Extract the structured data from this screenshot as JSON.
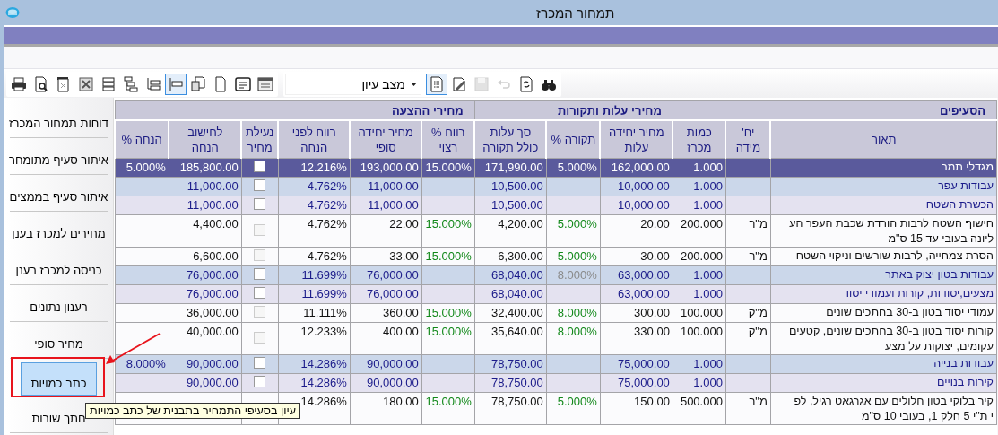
{
  "window": {
    "title": "תמחור המכרז"
  },
  "toolbar": {
    "left_tools": [
      {
        "kind": "print",
        "selected": false,
        "disabled": false
      },
      {
        "kind": "preview",
        "selected": false,
        "disabled": false
      },
      {
        "kind": "pdf",
        "selected": false,
        "disabled": false
      },
      {
        "kind": "excel",
        "selected": false,
        "disabled": false
      },
      {
        "kind": "tree-a",
        "selected": false,
        "disabled": false
      },
      {
        "kind": "tree-b",
        "selected": false,
        "disabled": false
      },
      {
        "kind": "tree-c",
        "selected": false,
        "disabled": false
      },
      {
        "kind": "tree-d",
        "selected": true,
        "disabled": false
      },
      {
        "kind": "copy",
        "selected": false,
        "disabled": false
      },
      {
        "kind": "page",
        "selected": false,
        "disabled": false
      },
      {
        "kind": "frame",
        "selected": false,
        "disabled": false
      },
      {
        "kind": "grid",
        "selected": false,
        "disabled": false
      }
    ],
    "mode_field": {
      "value": "מצב עיון"
    },
    "right_tools": [
      {
        "kind": "doc-list",
        "selected": true,
        "disabled": false
      },
      {
        "kind": "edit",
        "selected": false,
        "disabled": false
      },
      {
        "kind": "save",
        "selected": false,
        "disabled": true
      },
      {
        "kind": "undo",
        "selected": false,
        "disabled": true
      },
      {
        "kind": "refresh",
        "selected": false,
        "disabled": false
      },
      {
        "kind": "find",
        "selected": false,
        "disabled": false
      }
    ]
  },
  "sidebar": {
    "items": [
      {
        "label": "דוחות תמחור המכרז",
        "selected": false
      },
      {
        "label": "איתור סעיף מתומחר",
        "selected": false
      },
      {
        "label": "איתור סעיף בממצים",
        "selected": false
      },
      {
        "label": "מחירים למכרז בענן",
        "selected": false
      },
      {
        "label": "כניסה למכרז בענן",
        "selected": false
      },
      {
        "label": "רענון נתונים",
        "selected": false
      },
      {
        "label": "מחיר סופי",
        "selected": false
      },
      {
        "label": "כתב כמויות",
        "selected": true
      },
      {
        "label": "חתך שורות",
        "selected": false
      }
    ]
  },
  "tooltip": "עיון בסעיפי התמחיר בתבנית של כתב כמויות",
  "table": {
    "groups": [
      {
        "label": "הסעיפים"
      },
      {
        "label": "מחירי עלות ותקורות"
      },
      {
        "label": "מחירי ההצעה"
      }
    ],
    "columns": [
      "תאור",
      "יח'\nמידה",
      "כמות\nמכרז",
      "מחיר יחידה\nעלות",
      "תקורה %",
      "סך עלות\nכולל תקורה",
      "רווח %\nרצוי",
      "מחיר יחידה\nסופי",
      "רווח  לפני\nהנחה",
      "נעילת\nמחיר",
      "לחישוב\nהנחה",
      "הנחה %"
    ],
    "rows": [
      {
        "kind": "chapter",
        "selected": true,
        "overhead_greyed": false,
        "lock": {
          "checked": false,
          "disabled": false
        },
        "cells": [
          "מגדלי תמר",
          null,
          "1.000",
          "162,000.00",
          "5.000%",
          "171,990.00",
          "15.000%",
          "193,000.00",
          "12.216%",
          "",
          "185,800.00",
          "5.000%"
        ]
      },
      {
        "kind": "chapter",
        "selected": false,
        "overhead_greyed": false,
        "lock": {
          "checked": false,
          "disabled": false
        },
        "cells": [
          "עבודות עפר",
          null,
          "1.000",
          "10,000.00",
          null,
          "10,500.00",
          null,
          "11,000.00",
          "4.762%",
          "",
          "11,000.00",
          null
        ]
      },
      {
        "kind": "section",
        "selected": false,
        "overhead_greyed": false,
        "lock": {
          "checked": false,
          "disabled": false
        },
        "cells": [
          "הכשרת השטח",
          null,
          "1.000",
          "10,000.00",
          null,
          "10,500.00",
          null,
          "11,000.00",
          "4.762%",
          "",
          "11,000.00",
          null
        ]
      },
      {
        "kind": "item",
        "selected": false,
        "overhead_greyed": false,
        "lock": {
          "checked": false,
          "disabled": true
        },
        "cells": [
          "חישוף השטח לרבות הורדת שכבת העפר הע\nליונה בעובי עד 15 ס\"מ",
          "מ\"ר",
          "200.000",
          "20.00",
          "5.000%",
          "4,200.00",
          "15.000%",
          "22.00",
          "4.762%",
          "",
          "4,400.00",
          null
        ]
      },
      {
        "kind": "item",
        "selected": false,
        "overhead_greyed": false,
        "lock": {
          "checked": false,
          "disabled": true
        },
        "cells": [
          "הסרת צמחייה, לרבות שורשים וניקוי השטח",
          "מ\"ר",
          "200.000",
          "30.00",
          "5.000%",
          "6,300.00",
          "15.000%",
          "33.00",
          "4.762%",
          "",
          "6,600.00",
          null
        ]
      },
      {
        "kind": "chapter",
        "selected": false,
        "overhead_greyed": true,
        "lock": {
          "checked": false,
          "disabled": false
        },
        "cells": [
          "עבודות בטון יצוק באתר",
          null,
          "1.000",
          "63,000.00",
          "8.000%",
          "68,040.00",
          null,
          "76,000.00",
          "11.699%",
          "",
          "76,000.00",
          null
        ]
      },
      {
        "kind": "section",
        "selected": false,
        "overhead_greyed": false,
        "lock": {
          "checked": false,
          "disabled": false
        },
        "cells": [
          "מצעים,יסודות, קורות ועמודי יסוד",
          null,
          "1.000",
          "63,000.00",
          null,
          "68,040.00",
          null,
          "76,000.00",
          "11.699%",
          "",
          "76,000.00",
          null
        ]
      },
      {
        "kind": "item",
        "selected": false,
        "overhead_greyed": false,
        "lock": {
          "checked": false,
          "disabled": true
        },
        "cells": [
          "עמודי יסוד בטון ב-30 בחתכים שונים",
          "מ\"ק",
          "100.000",
          "300.00",
          "8.000%",
          "32,400.00",
          "15.000%",
          "360.00",
          "11.111%",
          "",
          "36,000.00",
          null
        ]
      },
      {
        "kind": "item",
        "selected": false,
        "overhead_greyed": false,
        "lock": {
          "checked": false,
          "disabled": true
        },
        "cells": [
          "קורות יסוד בטון ב-30 בחתכים שונים, קטעים\nעקומים, יצוקות על מצע",
          "מ\"ק",
          "100.000",
          "330.00",
          "8.000%",
          "35,640.00",
          "15.000%",
          "400.00",
          "12.233%",
          "",
          "40,000.00",
          null
        ]
      },
      {
        "kind": "chapter",
        "selected": false,
        "overhead_greyed": false,
        "lock": {
          "checked": false,
          "disabled": false
        },
        "cells": [
          "עבודות בנייה",
          null,
          "1.000",
          "75,000.00",
          null,
          "78,750.00",
          null,
          "90,000.00",
          "14.286%",
          "",
          "90,000.00",
          "8.000%"
        ]
      },
      {
        "kind": "section",
        "selected": false,
        "overhead_greyed": false,
        "lock": {
          "checked": false,
          "disabled": false
        },
        "cells": [
          "קירות בנויים",
          null,
          "1.000",
          "75,000.00",
          null,
          "78,750.00",
          null,
          "90,000.00",
          "14.286%",
          "",
          "90,000.00",
          null
        ]
      },
      {
        "kind": "item",
        "selected": false,
        "overhead_greyed": false,
        "cells": [
          "קיר בלוקי בטון חלולים עם אגרגאט רגיל, לפ\nי ת\"י 5 חלק 1, בעובי 10 ס\"מ",
          "מ\"ר",
          "500.000",
          "150.00",
          "5.000%",
          "78,750.00",
          "15.000%",
          "180.00",
          "14.286%",
          "",
          null,
          null
        ]
      }
    ]
  }
}
